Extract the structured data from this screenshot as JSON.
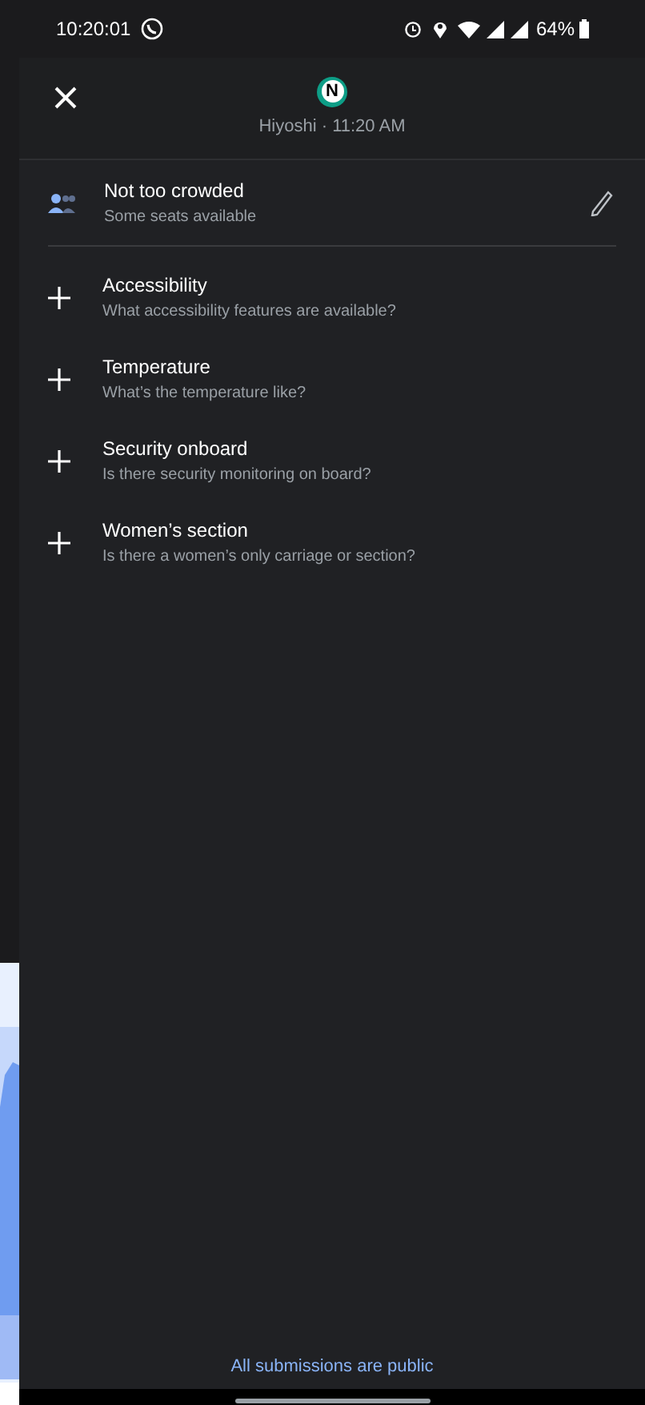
{
  "status_bar": {
    "time": "10:20:01",
    "battery": "64%"
  },
  "header": {
    "logo": "N",
    "subtitle": "Hiyoshi · 11:20 AM"
  },
  "crowding": {
    "title": "Not too crowded",
    "subtitle": "Some seats available"
  },
  "questions": [
    {
      "title": "Accessibility",
      "subtitle": "What accessibility features are available?"
    },
    {
      "title": "Temperature",
      "subtitle": "What’s the temperature like?"
    },
    {
      "title": "Security onboard",
      "subtitle": "Is there security monitoring on board?"
    },
    {
      "title": "Women’s section",
      "subtitle": "Is there a women’s only carriage or section?"
    }
  ],
  "footer": "All submissions are public"
}
